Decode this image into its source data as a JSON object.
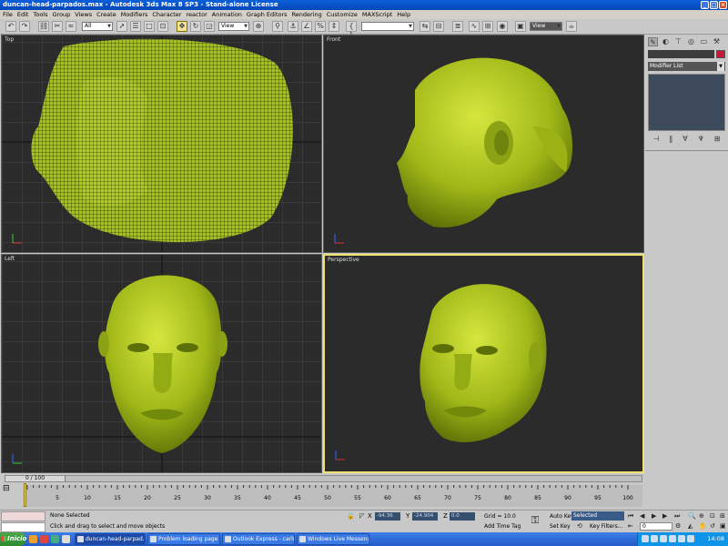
{
  "window": {
    "title": "duncan-head-parpados.max - Autodesk 3ds Max 8 SP3 - Stand-alone License"
  },
  "menu": [
    "File",
    "Edit",
    "Tools",
    "Group",
    "Views",
    "Create",
    "Modifiers",
    "Character",
    "reactor",
    "Animation",
    "Graph Editors",
    "Rendering",
    "Customize",
    "MAXScript",
    "Help"
  ],
  "toolbar": {
    "selection_filter": "All",
    "ref_coord": "View",
    "view_dropdown": "View"
  },
  "viewports": {
    "top": "Top",
    "front": "Front",
    "left": "Left",
    "perspective": "Perspective"
  },
  "command_panel": {
    "modifier_list": "Modifier List"
  },
  "timeline": {
    "frame_counter": "0 / 100",
    "current_frame": 0,
    "total_frames": 100,
    "ticks": [
      0,
      5,
      10,
      15,
      20,
      25,
      30,
      35,
      40,
      45,
      50,
      55,
      60,
      65,
      70,
      75,
      80,
      85,
      90,
      95,
      100
    ]
  },
  "status": {
    "selection": "None Selected",
    "prompt": "Click and drag to select and move objects",
    "x_label": "X",
    "y_label": "Y",
    "z_label": "Z",
    "x_value": "-94.36",
    "y_value": "-24.904",
    "z_value": "0.0",
    "grid": "Grid = 10.0",
    "add_time_tag": "Add Time Tag",
    "auto_key": "Auto Key",
    "set_key": "Set Key",
    "selected": "Selected",
    "key_filters": "Key Filters...",
    "frame_field": "0"
  },
  "taskbar": {
    "start": "Inicio",
    "tasks": [
      "duncan-head-parpad...",
      "Problem loading page - M...",
      "Outlook Express - carlos",
      "Windows Live Messenger"
    ],
    "clock": "14:08"
  },
  "colors": {
    "model": "#a4c01a",
    "viewport_bg": "#2b2b2b",
    "grid": "#4a4a4a",
    "active_border": "#f0e070"
  }
}
